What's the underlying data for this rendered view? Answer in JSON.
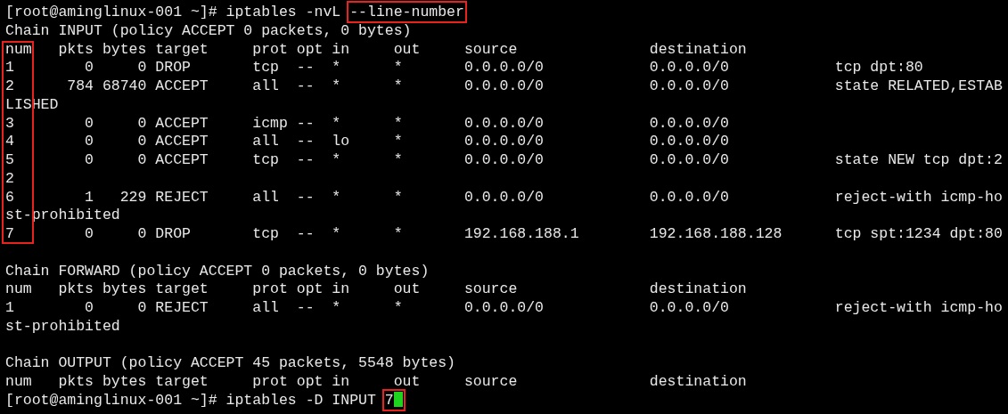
{
  "prompt_1": {
    "prompt": "[root@aminglinux-001 ~]#",
    "command_parts": [
      {
        "text": "iptables -nvL ",
        "highlighted": false
      },
      {
        "text": "--line-number",
        "highlighted": true
      }
    ]
  },
  "chains": [
    {
      "title": "Chain INPUT (policy ACCEPT 0 packets, 0 bytes)",
      "num_highlighted": true,
      "columns": [
        "num",
        "pkts",
        "bytes",
        "target",
        "prot",
        "opt",
        "in",
        "out",
        "source",
        "destination"
      ],
      "rows": [
        [
          "1",
          "0",
          "0",
          "DROP",
          "tcp",
          "--",
          "*",
          "*",
          "0.0.0.0/0",
          "0.0.0.0/0",
          "tcp dpt:80"
        ],
        [
          "2",
          "784",
          "68740",
          "ACCEPT",
          "all",
          "--",
          "*",
          "*",
          "0.0.0.0/0",
          "0.0.0.0/0",
          "state RELATED,ESTABLISHED"
        ],
        [
          "3",
          "0",
          "0",
          "ACCEPT",
          "icmp",
          "--",
          "*",
          "*",
          "0.0.0.0/0",
          "0.0.0.0/0"
        ],
        [
          "4",
          "0",
          "0",
          "ACCEPT",
          "all",
          "--",
          "lo",
          "*",
          "0.0.0.0/0",
          "0.0.0.0/0"
        ],
        [
          "5",
          "0",
          "0",
          "ACCEPT",
          "tcp",
          "--",
          "*",
          "*",
          "0.0.0.0/0",
          "0.0.0.0/0",
          "state NEW tcp dpt:22"
        ],
        [
          "6",
          "1",
          "229",
          "REJECT",
          "all",
          "--",
          "*",
          "*",
          "0.0.0.0/0",
          "0.0.0.0/0",
          "reject-with icmp-host-prohibited"
        ],
        [
          "7",
          "0",
          "0",
          "DROP",
          "tcp",
          "--",
          "*",
          "*",
          "192.168.188.1",
          "192.168.188.128",
          "tcp spt:1234 dpt:80"
        ]
      ]
    },
    {
      "title": "Chain FORWARD (policy ACCEPT 0 packets, 0 bytes)",
      "columns": [
        "num",
        "pkts",
        "bytes",
        "target",
        "prot",
        "opt",
        "in",
        "out",
        "source",
        "destination"
      ],
      "rows": [
        [
          "1",
          "0",
          "0",
          "REJECT",
          "all",
          "--",
          "*",
          "*",
          "0.0.0.0/0",
          "0.0.0.0/0",
          "reject-with icmp-host-prohibited"
        ]
      ]
    },
    {
      "title": "Chain OUTPUT (policy ACCEPT 45 packets, 5548 bytes)",
      "columns": [
        "num",
        "pkts",
        "bytes",
        "target",
        "prot",
        "opt",
        "in",
        "out",
        "source",
        "destination"
      ]
    }
  ],
  "prompt_2": {
    "prompt": "[root@aminglinux-001 ~]#",
    "command_parts": [
      {
        "text": "iptables -D INPUT ",
        "highlighted": false
      },
      {
        "text": "7",
        "highlighted": true
      }
    ],
    "cursor": true
  }
}
